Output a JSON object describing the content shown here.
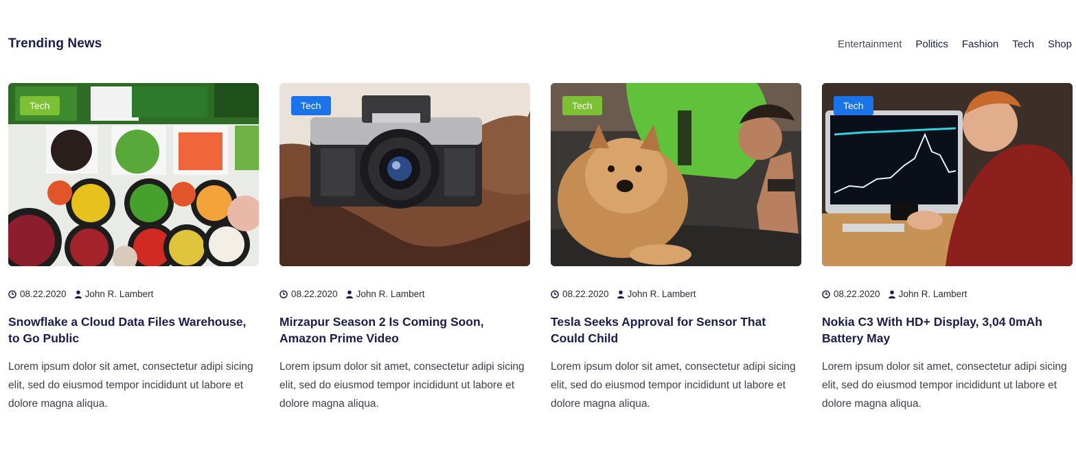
{
  "section": {
    "title": "Trending News"
  },
  "nav": {
    "items": [
      "Entertainment",
      "Politics",
      "Fashion",
      "Tech",
      "Shop"
    ]
  },
  "cards": [
    {
      "tag": "Tech",
      "tag_color": "#7cc133",
      "date": "08.22.2020",
      "author": "John R. Lambert",
      "title": "Snowflake a Cloud Data Files Warehouse, to Go Public",
      "excerpt": "Lorem ipsum dolor sit amet, consectetur adipi sicing elit, sed do eiusmod tempor incididunt ut labore et dolore magna aliqua."
    },
    {
      "tag": "Tech",
      "tag_color": "#1a73e8",
      "date": "08.22.2020",
      "author": "John R. Lambert",
      "title": "Mirzapur Season 2 Is Coming Soon, Amazon Prime Video",
      "excerpt": "Lorem ipsum dolor sit amet, consectetur adipi sicing elit, sed do eiusmod tempor incididunt ut labore et dolore magna aliqua."
    },
    {
      "tag": "Tech",
      "tag_color": "#7cc133",
      "date": "08.22.2020",
      "author": "John R. Lambert",
      "title": "Tesla Seeks Approval for Sensor That Could Child",
      "excerpt": "Lorem ipsum dolor sit amet, consectetur adipi sicing elit, sed do eiusmod tempor incididunt ut labore et dolore magna aliqua."
    },
    {
      "tag": "Tech",
      "tag_color": "#1a73e8",
      "date": "08.22.2020",
      "author": "John R. Lambert",
      "title": "Nokia C3 With HD+ Display, 3,04 0mAh Battery May",
      "excerpt": "Lorem ipsum dolor sit amet, consectetur adipi sicing elit, sed do eiusmod tempor incididunt ut labore et dolore magna aliqua."
    }
  ],
  "icons": {
    "date": "clock-icon",
    "author": "user-icon"
  },
  "colors": {
    "heading": "#1c1b4d",
    "tag_green": "#7cc133",
    "tag_blue": "#1a73e8"
  }
}
